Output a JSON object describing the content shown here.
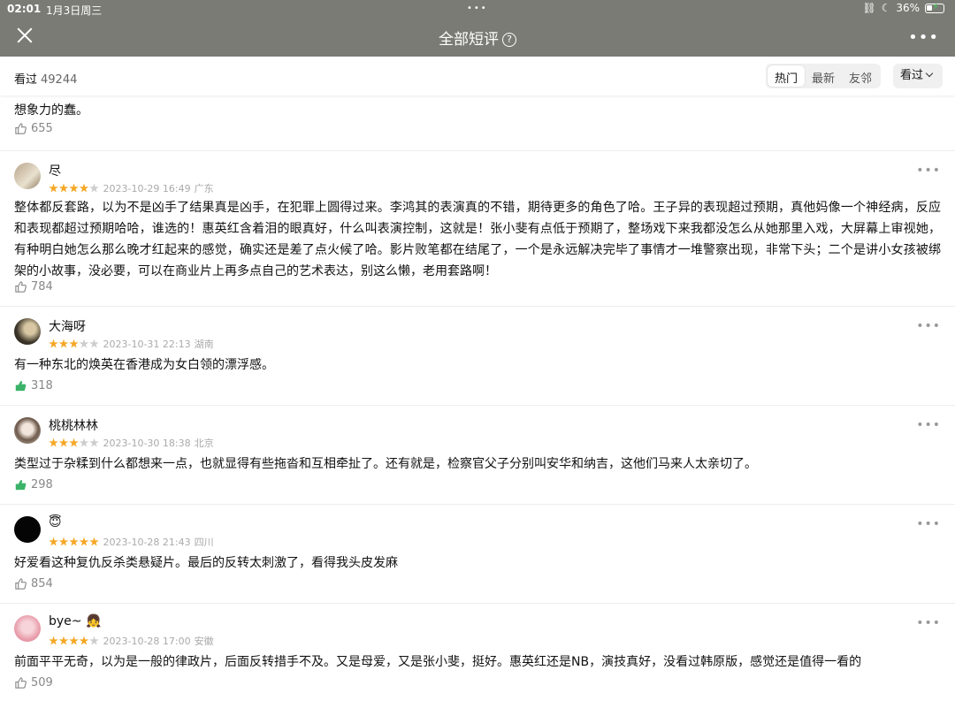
{
  "status": {
    "time": "02:01",
    "date": "1月3日周三",
    "battery": "36%"
  },
  "nav": {
    "title": "全部短评",
    "help_glyph": "?"
  },
  "filter": {
    "seen_label": "看过",
    "seen_count": "49244",
    "tabs": [
      {
        "label": "热门",
        "active": true
      },
      {
        "label": "最新",
        "active": false
      },
      {
        "label": "友邻",
        "active": false
      }
    ],
    "dropdown_label": "看过"
  },
  "partial": {
    "text": "想象力的蠢。",
    "likes": "655"
  },
  "reviews": [
    {
      "name": "尽",
      "stars": 4,
      "time": "2023-10-29 16:49",
      "location": "广东",
      "text": "整体都反套路，以为不是凶手了结果真是凶手，在犯罪上圆得过来。李鸿其的表演真的不错，期待更多的角色了哈。王子异的表现超过预期，真他妈像一个神经病，反应和表现都超过预期哈哈，谁选的！惠英红含着泪的眼真好，什么叫表演控制，这就是！张小斐有点低于预期了，整场戏下来我都没怎么从她那里入戏，大屏幕上审视她，有种明白她怎么那么晚才红起来的感觉，确实还是差了点火候了哈。影片败笔都在结尾了，一个是永远解决完毕了事情才一堆警察出现，非常下头；二个是讲小女孩被绑架的小故事，没必要，可以在商业片上再多点自己的艺术表达，别这么懒，老用套路啊！",
      "likes": "784",
      "liked": false
    },
    {
      "name": "大海呀",
      "stars": 3,
      "time": "2023-10-31 22:13",
      "location": "湖南",
      "text": "有一种东北的焕英在香港成为女白领的漂浮感。",
      "likes": "318",
      "liked": true
    },
    {
      "name": "桃桃林林",
      "stars": 3,
      "time": "2023-10-30 18:38",
      "location": "北京",
      "text": "类型过于杂糅到什么都想来一点，也就显得有些拖沓和互相牵扯了。还有就是，检察官父子分别叫安华和纳吉，这他们马来人太亲切了。",
      "likes": "298",
      "liked": true
    },
    {
      "name": "😇",
      "stars": 5,
      "time": "2023-10-28 21:43",
      "location": "四川",
      "text": "好爱看这种复仇反杀类悬疑片。最后的反转太刺激了，看得我头皮发麻",
      "likes": "854",
      "liked": false
    },
    {
      "name": "bye~ 👧",
      "stars": 4,
      "time": "2023-10-28 17:00",
      "location": "安徽",
      "text": "前面平平无奇，以为是一般的律政片，后面反转措手不及。又是母爱，又是张小斐，挺好。惠英红还是NB，演技真好，没看过韩原版，感觉还是值得一看的",
      "likes": "509",
      "liked": false
    }
  ],
  "colors": {
    "header": "#7b7b75",
    "star": "#f5a623",
    "liked": "#3bb36a"
  },
  "icons": {
    "close": "close-icon",
    "more": "more-icon",
    "like": "thumb-up-icon",
    "help": "help-icon"
  }
}
